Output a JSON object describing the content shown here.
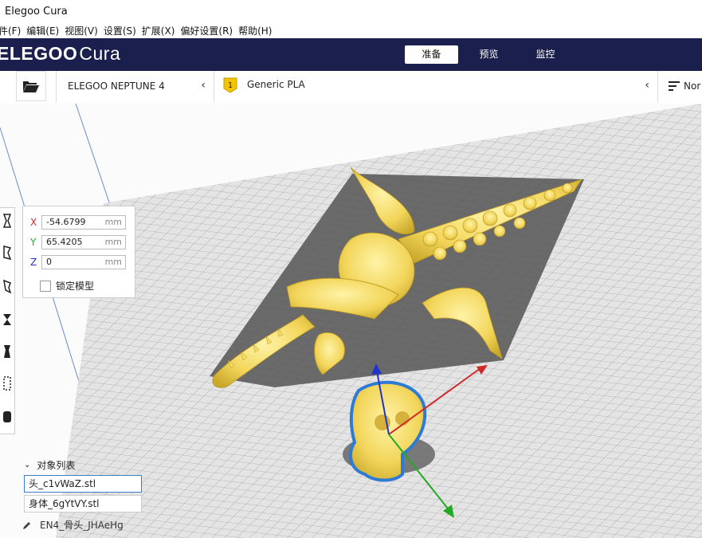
{
  "window": {
    "title": "Elegoo Cura"
  },
  "menu": [
    "件(F)",
    "编辑(E)",
    "视图(V)",
    "设置(S)",
    "扩展(X)",
    "偏好设置(R)",
    "帮助(H)"
  ],
  "header": {
    "logo_main": "ELEGOO",
    "logo_sub": "Cura",
    "stages": [
      {
        "label": "准备",
        "active": true
      },
      {
        "label": "预览",
        "active": false
      },
      {
        "label": "监控",
        "active": false
      }
    ]
  },
  "toolbar": {
    "printer": "ELEGOO NEPTUNE 4",
    "material_badge": "1",
    "material": "Generic PLA",
    "quality": "Nor"
  },
  "move_panel": {
    "x_label": "X",
    "x_value": "-54.6799",
    "y_label": "Y",
    "y_value": "65.4205",
    "z_label": "Z",
    "z_value": "0",
    "unit": "mm",
    "lock_label": "锁定模型"
  },
  "object_list": {
    "title": "对象列表",
    "items": [
      "头_c1vWaZ.stl",
      "身体_6gYtVY.stl"
    ]
  },
  "project_name": "EN4_骨头_JHAeHg",
  "colors": {
    "header_bg": "#1b1f4d",
    "model": "#f2d55a",
    "selection": "#2e7bd6",
    "x_axis": "#d02828",
    "y_axis": "#22aa22",
    "z_axis": "#2233cc"
  }
}
